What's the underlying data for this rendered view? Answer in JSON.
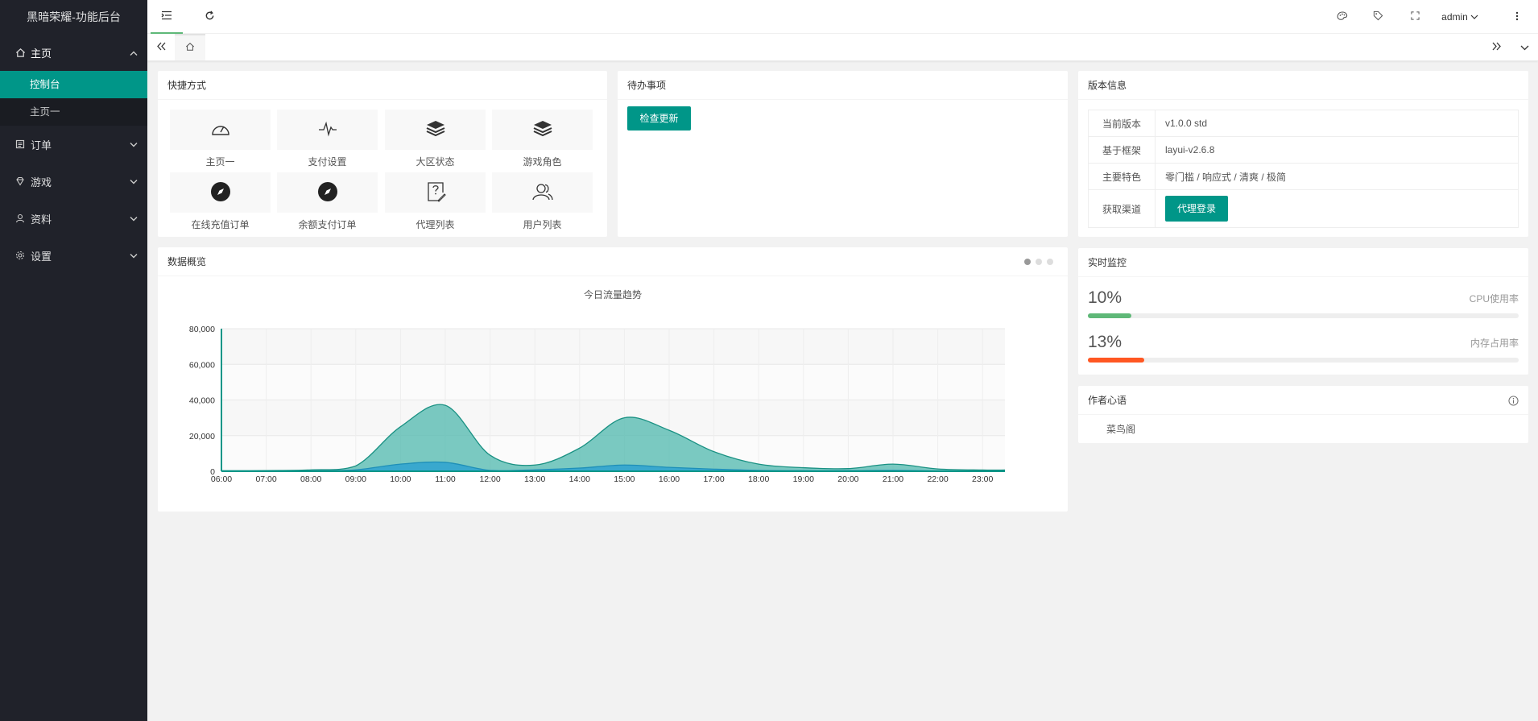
{
  "sidebar": {
    "logo": "黑暗荣耀-功能后台",
    "home_label": "主页",
    "home_sub": [
      "控制台",
      "主页一"
    ],
    "items": [
      {
        "label": "订单",
        "icon": "list-icon"
      },
      {
        "label": "游戏",
        "icon": "diamond-icon"
      },
      {
        "label": "资料",
        "icon": "user-icon"
      },
      {
        "label": "设置",
        "icon": "gear-icon"
      }
    ]
  },
  "header": {
    "user": "admin",
    "icons": [
      "menu-fold-icon",
      "refresh-icon",
      "theme-icon",
      "tag-icon",
      "fullscreen-icon",
      "more-icon"
    ]
  },
  "quick": {
    "title": "快捷方式",
    "items": [
      {
        "label": "主页一",
        "icon": "dashboard-icon"
      },
      {
        "label": "支付设置",
        "icon": "pulse-icon"
      },
      {
        "label": "大区状态",
        "icon": "layers-icon"
      },
      {
        "label": "游戏角色",
        "icon": "layers-icon"
      },
      {
        "label": "在线充值订单",
        "icon": "compass-icon"
      },
      {
        "label": "余额支付订单",
        "icon": "compass-icon"
      },
      {
        "label": "代理列表",
        "icon": "help-edit-icon"
      },
      {
        "label": "用户列表",
        "icon": "users-icon"
      }
    ]
  },
  "todo": {
    "title": "待办事项",
    "button": "检查更新"
  },
  "version": {
    "title": "版本信息",
    "rows": [
      {
        "key": "当前版本",
        "value": "v1.0.0 std"
      },
      {
        "key": "基于框架",
        "value": "layui-v2.6.8"
      },
      {
        "key": "主要特色",
        "value": "零门槛 / 响应式 / 清爽 / 极简"
      },
      {
        "key": "获取渠道",
        "button": "代理登录"
      }
    ]
  },
  "monitor": {
    "title": "实时监控",
    "cpu": {
      "value": "10%",
      "label": "CPU使用率",
      "fraction": 0.1,
      "color": "#5fb878"
    },
    "mem": {
      "value": "13%",
      "label": "内存占用率",
      "fraction": 0.13,
      "color": "#ff5722"
    }
  },
  "author": {
    "title": "作者心语",
    "text": "菜鸟阁"
  },
  "overview": {
    "title": "数据概览",
    "chart_data": {
      "type": "area",
      "title": "今日流量趋势",
      "xlabel": "",
      "ylabel": "",
      "ylim": [
        0,
        80000
      ],
      "yticks": [
        "0",
        "20,000",
        "40,000",
        "60,000",
        "80,000"
      ],
      "x": [
        "06:00",
        "07:00",
        "08:00",
        "09:00",
        "10:00",
        "11:00",
        "12:00",
        "13:00",
        "14:00",
        "15:00",
        "16:00",
        "17:00",
        "18:00",
        "19:00",
        "20:00",
        "21:00",
        "22:00",
        "23:00"
      ],
      "grid": true,
      "colors": [
        "#4fb8ad",
        "#2ea2d0"
      ],
      "series": [
        {
          "values": [
            300,
            400,
            800,
            3000,
            25000,
            37000,
            9000,
            3500,
            13000,
            30000,
            23000,
            11000,
            4000,
            2000,
            1500,
            4000,
            1300,
            700
          ]
        },
        {
          "values": [
            100,
            120,
            200,
            800,
            4000,
            5000,
            500,
            800,
            1800,
            3500,
            2200,
            1200,
            500,
            300,
            300,
            500,
            200,
            100
          ]
        }
      ]
    }
  }
}
